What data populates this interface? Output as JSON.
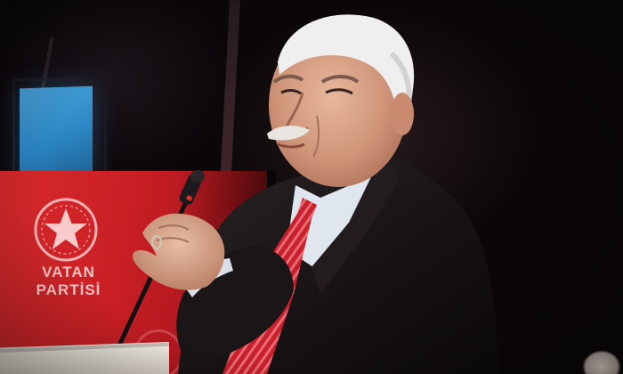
{
  "banner": {
    "party_name_line1": "VATAN",
    "party_name_line2": "PARTİSİ",
    "color": "#d82a2c"
  },
  "scene": {
    "subject": "speaker-at-podium",
    "icons": [
      "star-emblem-icon",
      "microphone-icon"
    ]
  }
}
